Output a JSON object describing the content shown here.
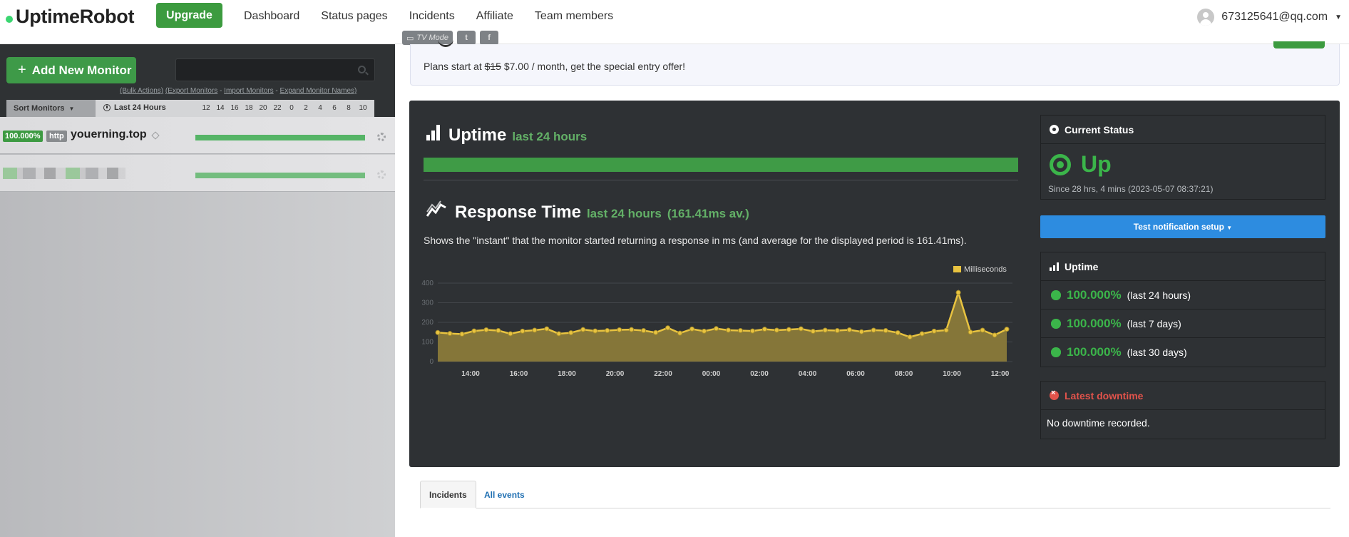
{
  "brand": {
    "name": "UptimeRobot"
  },
  "nav": {
    "upgrade_label": "Upgrade",
    "links": [
      "Dashboard",
      "Status pages",
      "Incidents",
      "Affiliate",
      "Team members"
    ],
    "user_email": "673125641@qq.com"
  },
  "tvbar": {
    "tv_mode": "TV Mode",
    "icon1": "twitter-icon",
    "icon2": "facebook-icon"
  },
  "sidebar": {
    "add_button": "Add New Monitor",
    "search_placeholder": "",
    "bulk_actions": "(Bulk Actions)",
    "export_monitors": "(Export Monitors",
    "import_monitors": "Import Monitors",
    "expand_names": "Expand Monitor Names)",
    "sort_label": "Sort Monitors",
    "period_label": "Last 24 Hours",
    "hours": [
      "12",
      "14",
      "16",
      "18",
      "20",
      "22",
      "0",
      "2",
      "4",
      "6",
      "8",
      "10"
    ],
    "monitors": [
      {
        "uptime": "100.000%",
        "type": "http",
        "name": "youerning.top"
      }
    ]
  },
  "promo": {
    "prefix": "Plans start at ",
    "old_price": "$15",
    "suffix": " $7.00 / month, get the special entry offer!"
  },
  "uptime_section": {
    "title": "Uptime",
    "subtitle": "last 24 hours"
  },
  "response_section": {
    "title": "Response Time",
    "subtitle": "last 24 hours",
    "average": "(161.41ms av.)",
    "description": "Shows the \"instant\" that the monitor started returning a response in ms (and average for the displayed period is 161.41ms)."
  },
  "chart_data": {
    "type": "area",
    "title": "Response Time",
    "legend": [
      "Milliseconds"
    ],
    "y_ticks": [
      "0",
      "100",
      "200",
      "300",
      "400"
    ],
    "x_ticks": [
      "14:00",
      "16:00",
      "18:00",
      "20:00",
      "22:00",
      "00:00",
      "02:00",
      "04:00",
      "06:00",
      "08:00",
      "10:00",
      "12:00"
    ],
    "ylim": [
      0,
      400
    ],
    "color": "#e8c340",
    "series": [
      {
        "name": "Milliseconds",
        "values": [
          148,
          143,
          140,
          156,
          162,
          158,
          142,
          155,
          160,
          167,
          142,
          147,
          163,
          156,
          158,
          162,
          163,
          158,
          148,
          172,
          145,
          166,
          155,
          168,
          160,
          158,
          156,
          165,
          160,
          163,
          167,
          154,
          160,
          158,
          162,
          152,
          160,
          158,
          147,
          125,
          142,
          155,
          160,
          352,
          150,
          160,
          135,
          165
        ]
      }
    ]
  },
  "current_status": {
    "title": "Current Status",
    "value": "Up",
    "since": "Since 28 hrs, 4 mins (2023-05-07 08:37:21)"
  },
  "notification_button": "Test notification setup",
  "uptime_box": {
    "title": "Uptime",
    "rows": [
      {
        "value": "100.000%",
        "period": "(last 24 hours)"
      },
      {
        "value": "100.000%",
        "period": "(last 7 days)"
      },
      {
        "value": "100.000%",
        "period": "(last 30 days)"
      }
    ]
  },
  "latest_downtime": {
    "title": "Latest downtime",
    "text": "No downtime recorded."
  },
  "tabs": {
    "incidents": "Incidents",
    "all_events": "All events"
  },
  "colors": {
    "accent_green": "#3bb54a",
    "panel_bg": "#2e3134",
    "chart_line": "#e8c340",
    "alert_red": "#e2534b",
    "button_blue": "#2d8ce0"
  }
}
